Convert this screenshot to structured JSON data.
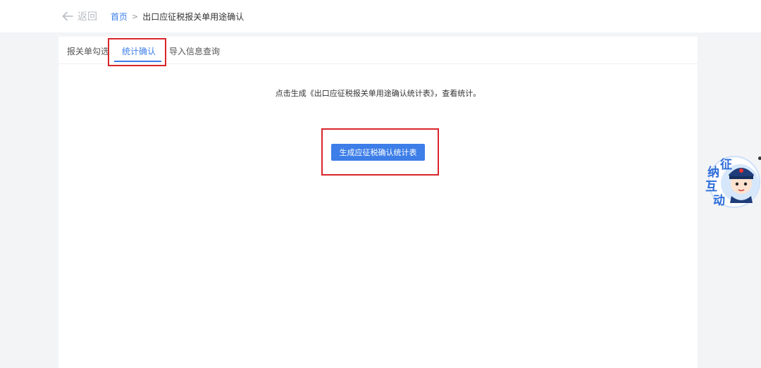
{
  "header": {
    "back_label": "返回",
    "breadcrumb_home": "首页",
    "breadcrumb_separator": ">",
    "breadcrumb_current": "出口应征税报关单用途确认"
  },
  "tabs": [
    {
      "label": "报关单勾选",
      "active": false
    },
    {
      "label": "统计确认",
      "active": true
    },
    {
      "label": "导入信息查询",
      "active": false
    }
  ],
  "content": {
    "instruction": "点击生成《出口应征税报关单用途确认统计表》，查看统计。",
    "generate_button": "生成应征税确认统计表"
  },
  "widget": {
    "chars": [
      "征",
      "纳",
      "互",
      "动"
    ],
    "icon": "tax-officer-mascot-icon"
  },
  "colors": {
    "accent": "#3d7ee8",
    "highlight_border": "#d9252b",
    "background": "#f3f4f6"
  }
}
